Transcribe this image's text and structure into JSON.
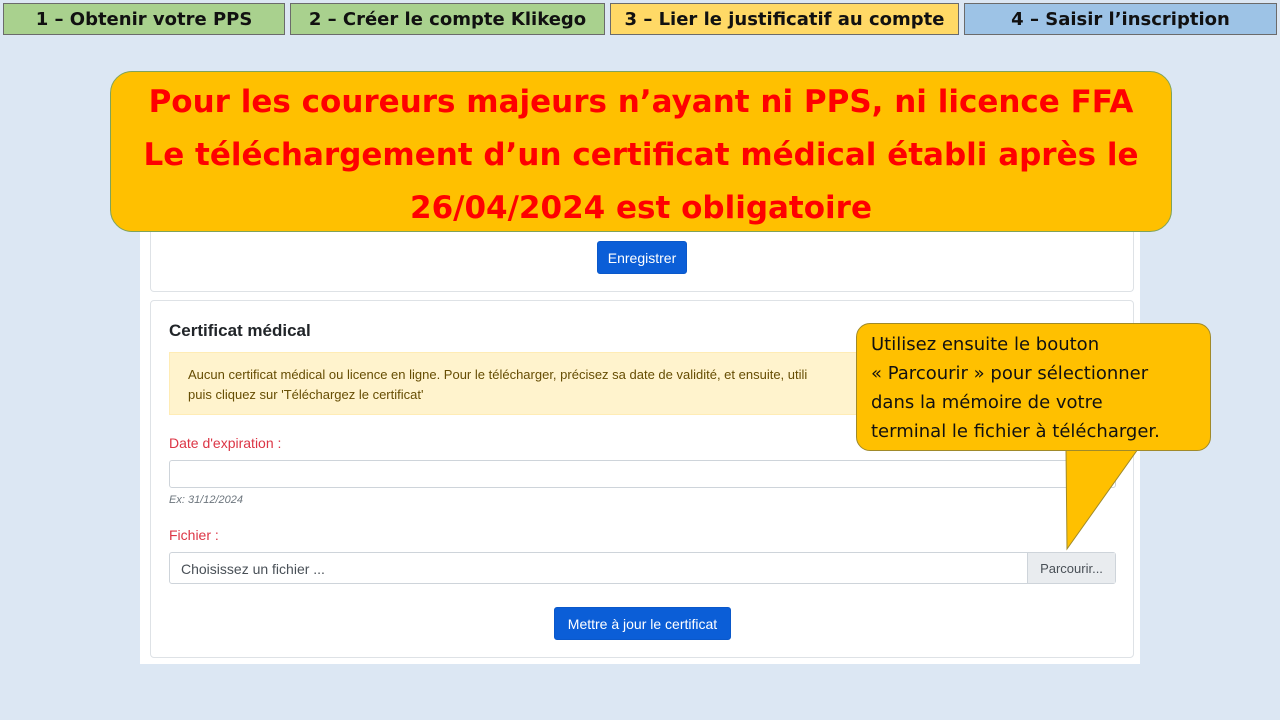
{
  "steps": [
    {
      "label": "1 – Obtenir votre PPS",
      "color": "#a9d18e"
    },
    {
      "label": "2 – Créer le compte Klikego",
      "color": "#a9d18e"
    },
    {
      "label": "3 – Lier le justificatif au compte",
      "color": "#ffd966"
    },
    {
      "label": "4 – Saisir l’inscription",
      "color": "#9dc3e6"
    }
  ],
  "banner": {
    "line1": "Pour les coureurs majeurs n’ayant ni PPS, ni licence FFA",
    "line2": "Le téléchargement d’un certificat médical établi après le",
    "line3": "26/04/2024 est obligatoire"
  },
  "form": {
    "save_button": "Enregistrer",
    "card_title": "Certificat médical",
    "alert_line1": "Aucun certificat médical ou licence en ligne. Pour le télécharger, précisez sa date de validité, et ensuite, utili",
    "alert_line2": "puis cliquez sur 'Téléchargez le certificat'",
    "expiration_label": "Date d'expiration :",
    "expiration_value": "",
    "expiration_hint": "Ex: 31/12/2024",
    "file_label": "Fichier :",
    "file_placeholder": "Choisissez un fichier ...",
    "browse_button": "Parcourir...",
    "update_button": "Mettre à jour le certificat"
  },
  "callout": {
    "line1": "Utilisez ensuite le bouton",
    "line2": "« Parcourir » pour sélectionner",
    "line3": "dans la mémoire de votre",
    "line4": "terminal le fichier à télécharger."
  }
}
